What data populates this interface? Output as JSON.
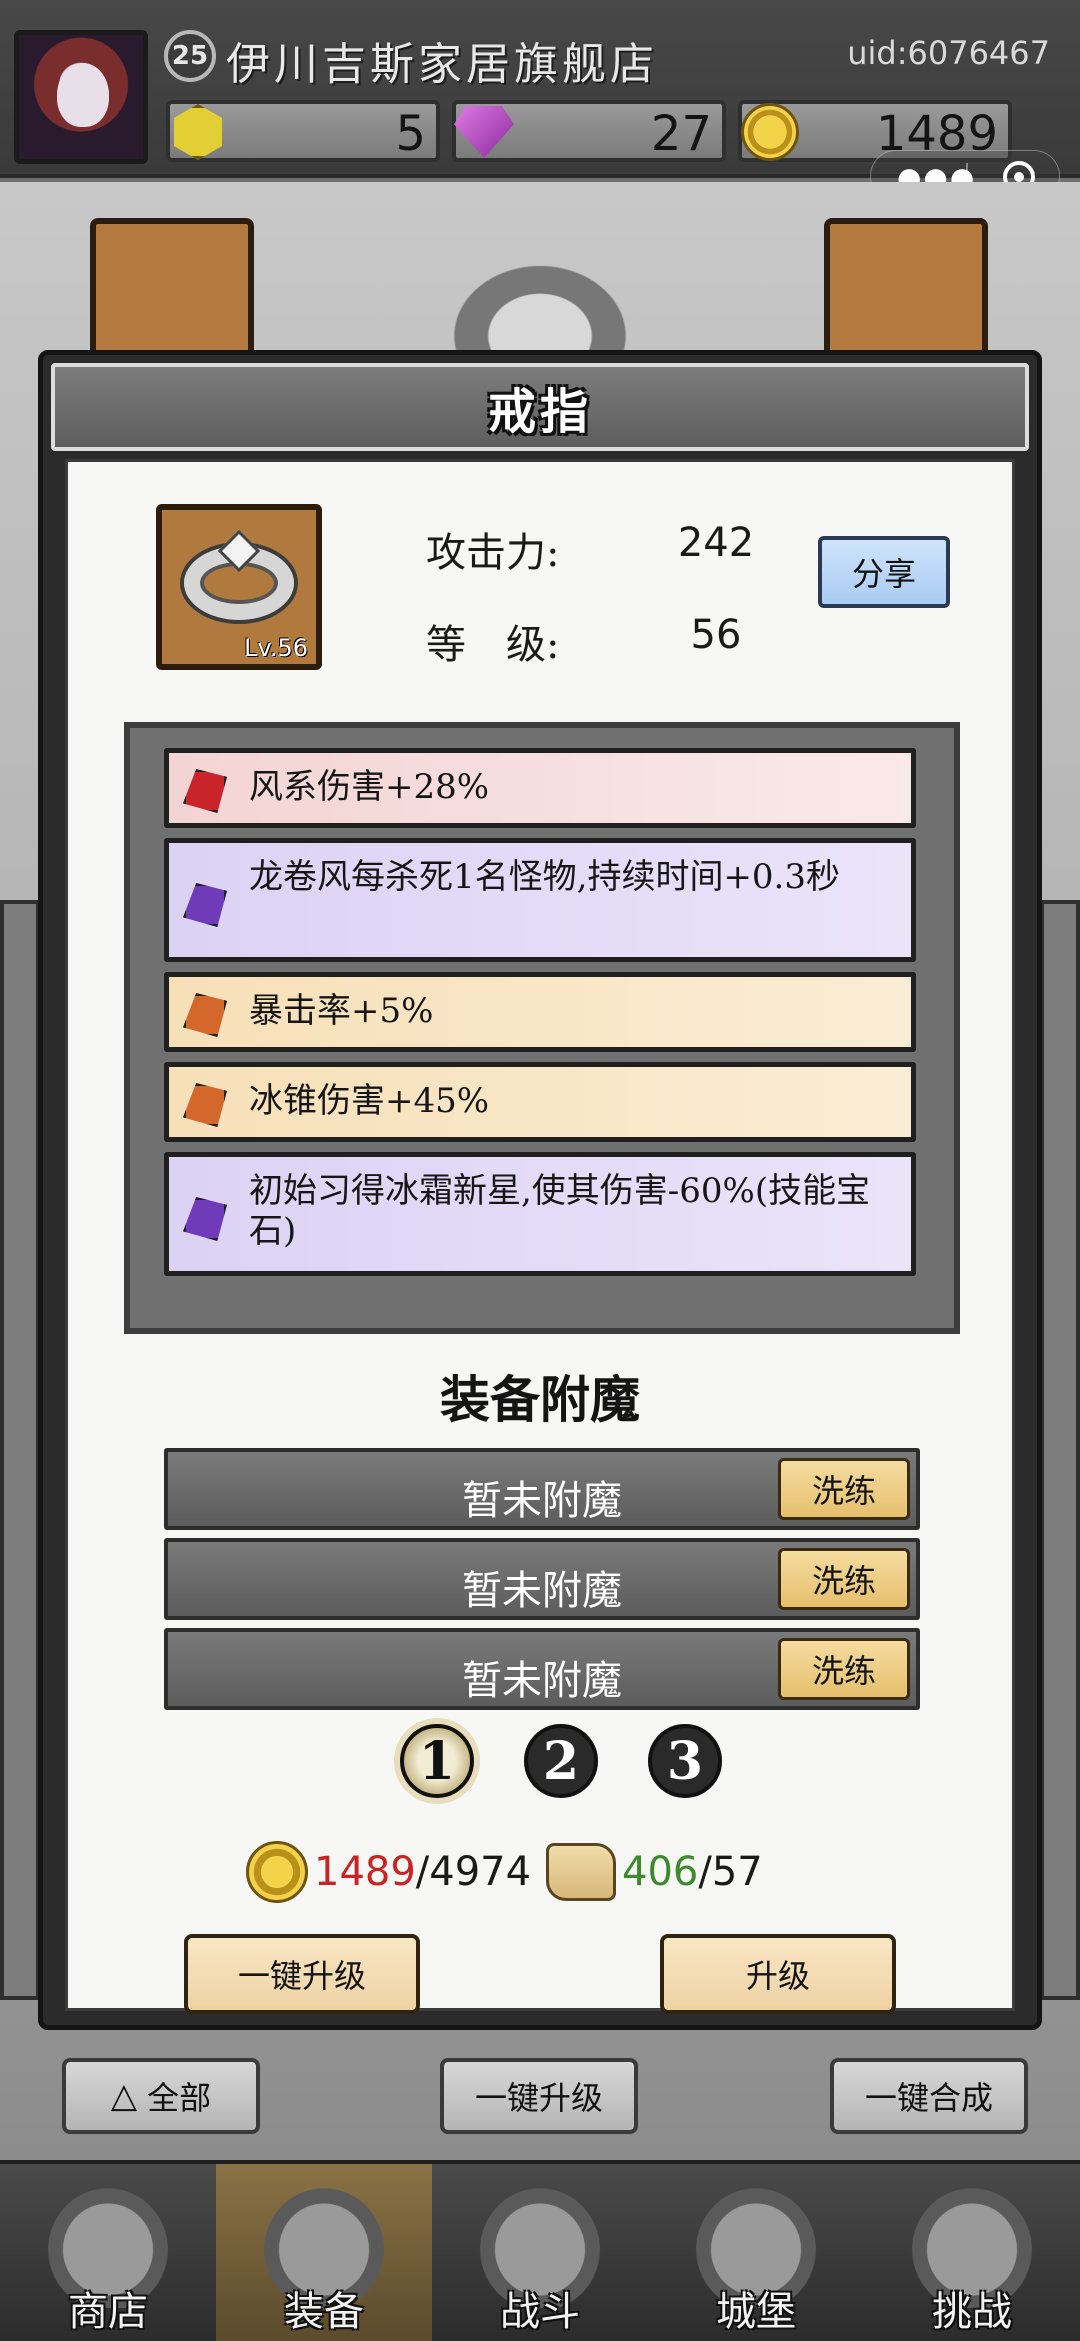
{
  "header": {
    "player_level": "25",
    "shop_name": "伊川吉斯家居旗舰店",
    "uid": "uid:6076467",
    "resources": [
      {
        "icon": "gold-hexagon-icon",
        "value": "5"
      },
      {
        "icon": "purple-diamond-icon",
        "value": "27"
      },
      {
        "icon": "gold-coin-icon",
        "value": "1489"
      }
    ]
  },
  "dialog": {
    "title": "戒指",
    "item": {
      "icon": "ring-icon",
      "level_badge": "Lv.56",
      "attack_label": "攻击力:",
      "attack_value": "242",
      "level_label": "等　级:",
      "level_value": "56",
      "share_label": "分享"
    },
    "affixes": [
      {
        "gem": "red",
        "text": "风系伤害+28%"
      },
      {
        "gem": "purple",
        "text": "龙卷风每杀死1名怪物,持续时间+0.3秒"
      },
      {
        "gem": "orange",
        "text": "暴击率+5%"
      },
      {
        "gem": "orange",
        "text": "冰锥伤害+45%"
      },
      {
        "gem": "purple",
        "text": "初始习得冰霜新星,使其伤害-60%(技能宝石)"
      }
    ],
    "enchant": {
      "title": "装备附魔",
      "slots": [
        {
          "text": "暂未附魔",
          "button": "洗练"
        },
        {
          "text": "暂未附魔",
          "button": "洗练"
        },
        {
          "text": "暂未附魔",
          "button": "洗练"
        }
      ],
      "pages": [
        "1",
        "2",
        "3"
      ],
      "active_page": "1"
    },
    "costs": {
      "gold_have": "1489",
      "gold_need": "/4974",
      "scroll_have": "406",
      "scroll_need": "/57"
    },
    "buttons": {
      "one_click_upgrade": "一键升级",
      "upgrade": "升级"
    }
  },
  "sub_buttons": {
    "filter_all": "全部",
    "one_click_upgrade": "一键升级",
    "one_click_merge": "一键合成"
  },
  "bottom_nav": [
    {
      "label": "商店",
      "icon": "shop-icon"
    },
    {
      "label": "装备",
      "icon": "backpack-icon"
    },
    {
      "label": "战斗",
      "icon": "crossed-swords-icon"
    },
    {
      "label": "城堡",
      "icon": "castle-icon"
    },
    {
      "label": "挑战",
      "icon": "challenge-shield-icon"
    }
  ],
  "colors": {
    "insufficient": "#c92424",
    "sufficient": "#3c8a2c",
    "affix_red": "#c9242a",
    "affix_purple": "#6f3bb8",
    "affix_orange": "#d4682c"
  }
}
